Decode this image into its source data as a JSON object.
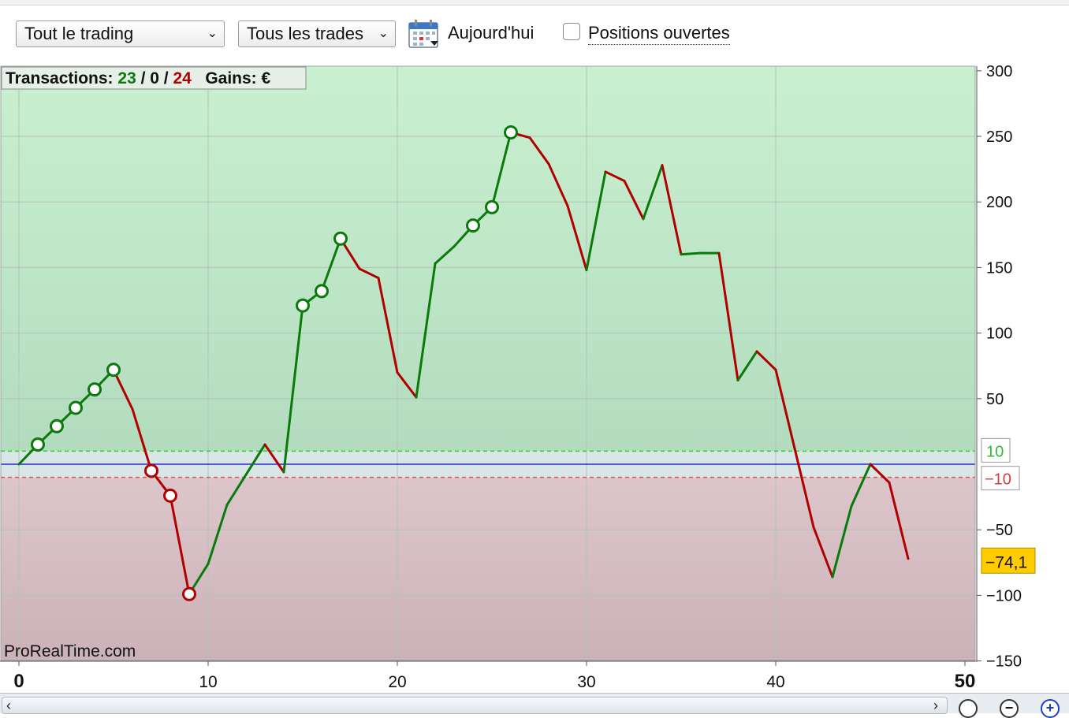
{
  "toolbar": {
    "mode_select": "Tout le trading",
    "trades_select": "Tous les trades",
    "today_label": "Aujourd'hui",
    "open_positions_label": "Positions ouvertes",
    "open_positions_checked": false
  },
  "chart_data": {
    "type": "line",
    "summary": {
      "transactions_label": "Transactions:",
      "wins": "23",
      "sep1": "/",
      "neutral": "0",
      "sep2": "/",
      "losses": "24",
      "gains_label": "Gains:",
      "currency": "€"
    },
    "watermark": "ProRealTime.com",
    "x": [
      0,
      1,
      2,
      3,
      4,
      5,
      6,
      7,
      8,
      9,
      10,
      11,
      12,
      13,
      14,
      15,
      16,
      17,
      18,
      19,
      20,
      21,
      22,
      23,
      24,
      25,
      26,
      27,
      28,
      29,
      30,
      31,
      32,
      33,
      34,
      35,
      36,
      37,
      38,
      39,
      40,
      41,
      42,
      43,
      44,
      45,
      46,
      47
    ],
    "y": [
      0,
      15,
      29,
      43,
      57,
      72,
      42,
      -5,
      -24,
      -99,
      -76,
      -31,
      -8,
      15,
      -6,
      121,
      132,
      172,
      149,
      142,
      70,
      51,
      153,
      166,
      182,
      196,
      253,
      249,
      229,
      197,
      148,
      223,
      216,
      187,
      228,
      160,
      161,
      161,
      64,
      86,
      72,
      12,
      -48,
      -86,
      -32,
      0,
      -14,
      -72
    ],
    "markers": [
      1,
      2,
      3,
      4,
      5,
      7,
      8,
      9,
      15,
      16,
      17,
      24,
      25,
      26
    ],
    "xlim": [
      0,
      50
    ],
    "ylim": [
      -150,
      300
    ],
    "x_ticks": [
      "0",
      "10",
      "20",
      "30",
      "40",
      "50"
    ],
    "y_ticks": [
      "300",
      "250",
      "200",
      "150",
      "100",
      "50",
      "-50",
      "-100",
      "-150"
    ],
    "upper_threshold": 10,
    "lower_threshold": -10,
    "upper_threshold_label": "10",
    "lower_threshold_label": "-10",
    "current_value": -74.1,
    "current_value_label": "-74,1",
    "colors": {
      "gain": "#0a7a0a",
      "loss": "#b00000",
      "zero_line": "#2a2ad6",
      "upper_threshold": "#33cc33",
      "lower_threshold": "#e05050",
      "current_badge": "#ffcc00"
    }
  },
  "zoom": {
    "zoom_in": "+",
    "zoom_out": "−"
  }
}
